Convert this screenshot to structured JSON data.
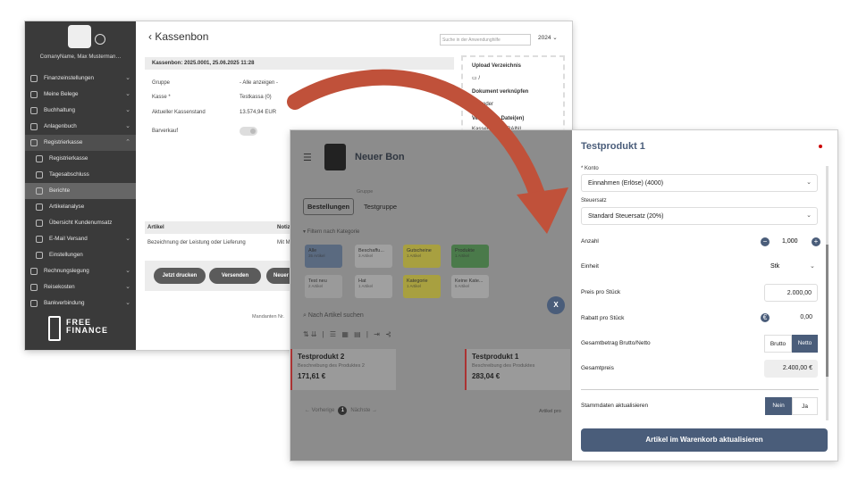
{
  "win1": {
    "company": "ComanyName, Max Musterman…",
    "sidebar": [
      {
        "label": "Finanzeinstellungen",
        "chev": "⌄"
      },
      {
        "label": "Meine Belege",
        "chev": "⌄"
      },
      {
        "label": "Buchhaltung",
        "chev": "⌄"
      },
      {
        "label": "Anlagenbuch",
        "chev": "⌄"
      },
      {
        "label": "Registrierkasse",
        "chev": "⌃"
      },
      {
        "label": "Registrierkasse"
      },
      {
        "label": "Tagesabschluss"
      },
      {
        "label": "Berichte"
      },
      {
        "label": "Artikelanalyse"
      },
      {
        "label": "Übersicht Kundenumsatz"
      },
      {
        "label": "E-Mail Versand",
        "chev": "⌄"
      },
      {
        "label": "Einstellungen"
      },
      {
        "label": "Rechnungslegung",
        "chev": "⌄"
      },
      {
        "label": "Reisekosten",
        "chev": "⌄"
      },
      {
        "label": "Bankverbindung",
        "chev": "⌄"
      }
    ],
    "brand": "FREE FINANCE",
    "title": "Kassenbon",
    "search_placeholder": "Suche in der Anwendunghilfe",
    "year": "2024 ⌄",
    "bon_header": "Kassenbon: 2025.0001, 25.06.2025 11:28",
    "form": [
      {
        "label": "Gruppe",
        "value": "- Alle anzeigen -"
      },
      {
        "label": "Kasse *",
        "value": "Testkassa (0)"
      },
      {
        "label": "Aktueller Kassenstand",
        "value": "13.574,94 EUR"
      },
      {
        "label": "Barverkauf",
        "value": ""
      }
    ],
    "upload": {
      "title": "Upload Verzeichnis",
      "path": "/",
      "doc_link": "Dokument verknüpfen",
      "oder": "oder",
      "files": "Verknüpfte Datei(en)",
      "file": "Kassenbon_(TRAINI…"
    },
    "table": {
      "col1": "Artikel",
      "col2": "Notiz",
      "row1": "Bezeichnung der Leistung oder Lieferung",
      "row2": "Mit M"
    },
    "buttons": [
      "Jetzt drucken",
      "Versenden",
      "Neuer"
    ],
    "mandant": "Mandanten Nr."
  },
  "win2": {
    "title": "Neuer Bon",
    "tabs": {
      "active": "Bestellungen",
      "gruppe_label": "Gruppe",
      "gruppe": "Testgruppe"
    },
    "filter": "Filtern nach Kategorie",
    "categories": [
      {
        "name": "Alle",
        "count": "35 Artikel",
        "color": "#5a6a80"
      },
      {
        "name": "Beschaffu...",
        "count": "3 Artikel",
        "color": "#a0a0a0"
      },
      {
        "name": "Gutscheine",
        "count": "1 Artikel",
        "color": "#a8a040"
      },
      {
        "name": "Produkte",
        "count": "1 Artikel",
        "color": "#4a7a4a"
      },
      {
        "name": "Test neu",
        "count": "2 Artikel",
        "color": "#9a9a9a"
      },
      {
        "name": "Hat",
        "count": "1 Artikel",
        "color": "#a0a0a0"
      },
      {
        "name": "Kategorie",
        "count": "1 Artikel",
        "color": "#a8a040"
      },
      {
        "name": "Keine Kate...",
        "count": "5 Artikel",
        "color": "#a0a0a0"
      }
    ],
    "search": "Nach Artikel suchen",
    "products": [
      {
        "name": "Testprodukt 2",
        "desc": "Beschreibung des Produktes 2",
        "price": "171,61 €"
      },
      {
        "name": "Testprodukt 1",
        "desc": "Beschreibung des Produktes",
        "price": "283,04 €"
      }
    ],
    "pager": {
      "prev": "← Vorherige",
      "page": "1",
      "next": "Nächste →"
    },
    "artikel": "Artikel pro",
    "close": "X",
    "panel": {
      "title": "Testprodukt 1",
      "konto_label": "* Konto",
      "konto": "Einnahmen (Erlöse) (4000)",
      "steuer_label": "Steuersatz",
      "steuer": "Standard Steuersatz (20%)",
      "anzahl_label": "Anzahl",
      "anzahl": "1,000",
      "einheit_label": "Einheit",
      "einheit": "Stk",
      "preis_label": "Preis pro Stück",
      "preis": "2.000,00",
      "rabatt_label": "Rabatt pro Stück",
      "rabatt": "0,00",
      "gesamt_label": "Gesamtbetrag Brutto/Netto",
      "brutto": "Brutto",
      "netto": "Netto",
      "gesamtpreis_label": "Gesamtpreis",
      "gesamtpreis": "2.400,00 €",
      "stamm_label": "Stammdaten aktualisieren",
      "nein": "Nein",
      "ja": "Ja",
      "submit": "Artikel im Warenkorb aktualisieren"
    }
  },
  "colors": {
    "accent": "#4a5d7a",
    "arrow": "#c0513a",
    "sidebar": "#3a3a3a"
  }
}
